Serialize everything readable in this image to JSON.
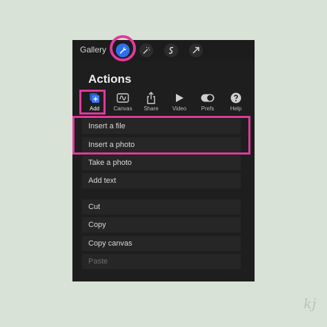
{
  "topbar": {
    "gallery_label": "Gallery",
    "tools": [
      {
        "icon": "wrench-icon",
        "active": true
      },
      {
        "icon": "magic-wand-icon",
        "active": false
      },
      {
        "icon": "selection-icon",
        "active": false
      },
      {
        "icon": "transform-arrow-icon",
        "active": false
      }
    ]
  },
  "actions": {
    "title": "Actions",
    "tabs": [
      {
        "label": "Add",
        "icon": "add-layers-icon",
        "active": true
      },
      {
        "label": "Canvas",
        "icon": "canvas-icon",
        "active": false
      },
      {
        "label": "Share",
        "icon": "share-icon",
        "active": false
      },
      {
        "label": "Video",
        "icon": "play-icon",
        "active": false
      },
      {
        "label": "Prefs",
        "icon": "toggle-icon",
        "active": false
      },
      {
        "label": "Help",
        "icon": "question-icon",
        "active": false
      }
    ],
    "group1": [
      {
        "label": "Insert a file",
        "enabled": true
      },
      {
        "label": "Insert a photo",
        "enabled": true
      },
      {
        "label": "Take a photo",
        "enabled": true
      },
      {
        "label": "Add text",
        "enabled": true
      }
    ],
    "group2": [
      {
        "label": "Cut",
        "enabled": true
      },
      {
        "label": "Copy",
        "enabled": true
      },
      {
        "label": "Copy canvas",
        "enabled": true
      },
      {
        "label": "Paste",
        "enabled": false
      }
    ]
  },
  "colors": {
    "accent": "#e23a9b",
    "active_tool": "#2e6ff0",
    "background": "#d8e2d6",
    "panel": "#1e1e1e"
  },
  "watermark": "kj"
}
